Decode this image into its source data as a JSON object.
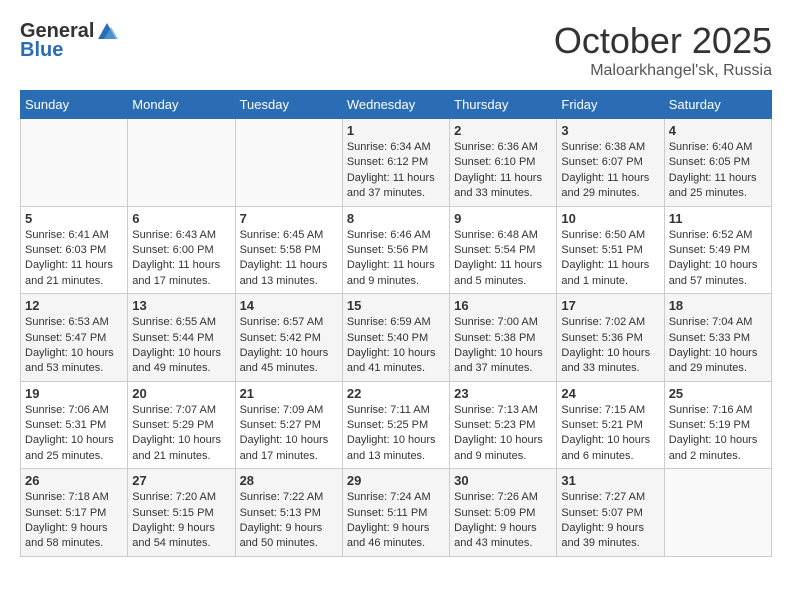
{
  "header": {
    "logo_general": "General",
    "logo_blue": "Blue",
    "month": "October 2025",
    "location": "Maloarkhangel'sk, Russia"
  },
  "weekdays": [
    "Sunday",
    "Monday",
    "Tuesday",
    "Wednesday",
    "Thursday",
    "Friday",
    "Saturday"
  ],
  "weeks": [
    [
      {
        "day": "",
        "info": ""
      },
      {
        "day": "",
        "info": ""
      },
      {
        "day": "",
        "info": ""
      },
      {
        "day": "1",
        "info": "Sunrise: 6:34 AM\nSunset: 6:12 PM\nDaylight: 11 hours\nand 37 minutes."
      },
      {
        "day": "2",
        "info": "Sunrise: 6:36 AM\nSunset: 6:10 PM\nDaylight: 11 hours\nand 33 minutes."
      },
      {
        "day": "3",
        "info": "Sunrise: 6:38 AM\nSunset: 6:07 PM\nDaylight: 11 hours\nand 29 minutes."
      },
      {
        "day": "4",
        "info": "Sunrise: 6:40 AM\nSunset: 6:05 PM\nDaylight: 11 hours\nand 25 minutes."
      }
    ],
    [
      {
        "day": "5",
        "info": "Sunrise: 6:41 AM\nSunset: 6:03 PM\nDaylight: 11 hours\nand 21 minutes."
      },
      {
        "day": "6",
        "info": "Sunrise: 6:43 AM\nSunset: 6:00 PM\nDaylight: 11 hours\nand 17 minutes."
      },
      {
        "day": "7",
        "info": "Sunrise: 6:45 AM\nSunset: 5:58 PM\nDaylight: 11 hours\nand 13 minutes."
      },
      {
        "day": "8",
        "info": "Sunrise: 6:46 AM\nSunset: 5:56 PM\nDaylight: 11 hours\nand 9 minutes."
      },
      {
        "day": "9",
        "info": "Sunrise: 6:48 AM\nSunset: 5:54 PM\nDaylight: 11 hours\nand 5 minutes."
      },
      {
        "day": "10",
        "info": "Sunrise: 6:50 AM\nSunset: 5:51 PM\nDaylight: 11 hours\nand 1 minute."
      },
      {
        "day": "11",
        "info": "Sunrise: 6:52 AM\nSunset: 5:49 PM\nDaylight: 10 hours\nand 57 minutes."
      }
    ],
    [
      {
        "day": "12",
        "info": "Sunrise: 6:53 AM\nSunset: 5:47 PM\nDaylight: 10 hours\nand 53 minutes."
      },
      {
        "day": "13",
        "info": "Sunrise: 6:55 AM\nSunset: 5:44 PM\nDaylight: 10 hours\nand 49 minutes."
      },
      {
        "day": "14",
        "info": "Sunrise: 6:57 AM\nSunset: 5:42 PM\nDaylight: 10 hours\nand 45 minutes."
      },
      {
        "day": "15",
        "info": "Sunrise: 6:59 AM\nSunset: 5:40 PM\nDaylight: 10 hours\nand 41 minutes."
      },
      {
        "day": "16",
        "info": "Sunrise: 7:00 AM\nSunset: 5:38 PM\nDaylight: 10 hours\nand 37 minutes."
      },
      {
        "day": "17",
        "info": "Sunrise: 7:02 AM\nSunset: 5:36 PM\nDaylight: 10 hours\nand 33 minutes."
      },
      {
        "day": "18",
        "info": "Sunrise: 7:04 AM\nSunset: 5:33 PM\nDaylight: 10 hours\nand 29 minutes."
      }
    ],
    [
      {
        "day": "19",
        "info": "Sunrise: 7:06 AM\nSunset: 5:31 PM\nDaylight: 10 hours\nand 25 minutes."
      },
      {
        "day": "20",
        "info": "Sunrise: 7:07 AM\nSunset: 5:29 PM\nDaylight: 10 hours\nand 21 minutes."
      },
      {
        "day": "21",
        "info": "Sunrise: 7:09 AM\nSunset: 5:27 PM\nDaylight: 10 hours\nand 17 minutes."
      },
      {
        "day": "22",
        "info": "Sunrise: 7:11 AM\nSunset: 5:25 PM\nDaylight: 10 hours\nand 13 minutes."
      },
      {
        "day": "23",
        "info": "Sunrise: 7:13 AM\nSunset: 5:23 PM\nDaylight: 10 hours\nand 9 minutes."
      },
      {
        "day": "24",
        "info": "Sunrise: 7:15 AM\nSunset: 5:21 PM\nDaylight: 10 hours\nand 6 minutes."
      },
      {
        "day": "25",
        "info": "Sunrise: 7:16 AM\nSunset: 5:19 PM\nDaylight: 10 hours\nand 2 minutes."
      }
    ],
    [
      {
        "day": "26",
        "info": "Sunrise: 7:18 AM\nSunset: 5:17 PM\nDaylight: 9 hours\nand 58 minutes."
      },
      {
        "day": "27",
        "info": "Sunrise: 7:20 AM\nSunset: 5:15 PM\nDaylight: 9 hours\nand 54 minutes."
      },
      {
        "day": "28",
        "info": "Sunrise: 7:22 AM\nSunset: 5:13 PM\nDaylight: 9 hours\nand 50 minutes."
      },
      {
        "day": "29",
        "info": "Sunrise: 7:24 AM\nSunset: 5:11 PM\nDaylight: 9 hours\nand 46 minutes."
      },
      {
        "day": "30",
        "info": "Sunrise: 7:26 AM\nSunset: 5:09 PM\nDaylight: 9 hours\nand 43 minutes."
      },
      {
        "day": "31",
        "info": "Sunrise: 7:27 AM\nSunset: 5:07 PM\nDaylight: 9 hours\nand 39 minutes."
      },
      {
        "day": "",
        "info": ""
      }
    ]
  ]
}
